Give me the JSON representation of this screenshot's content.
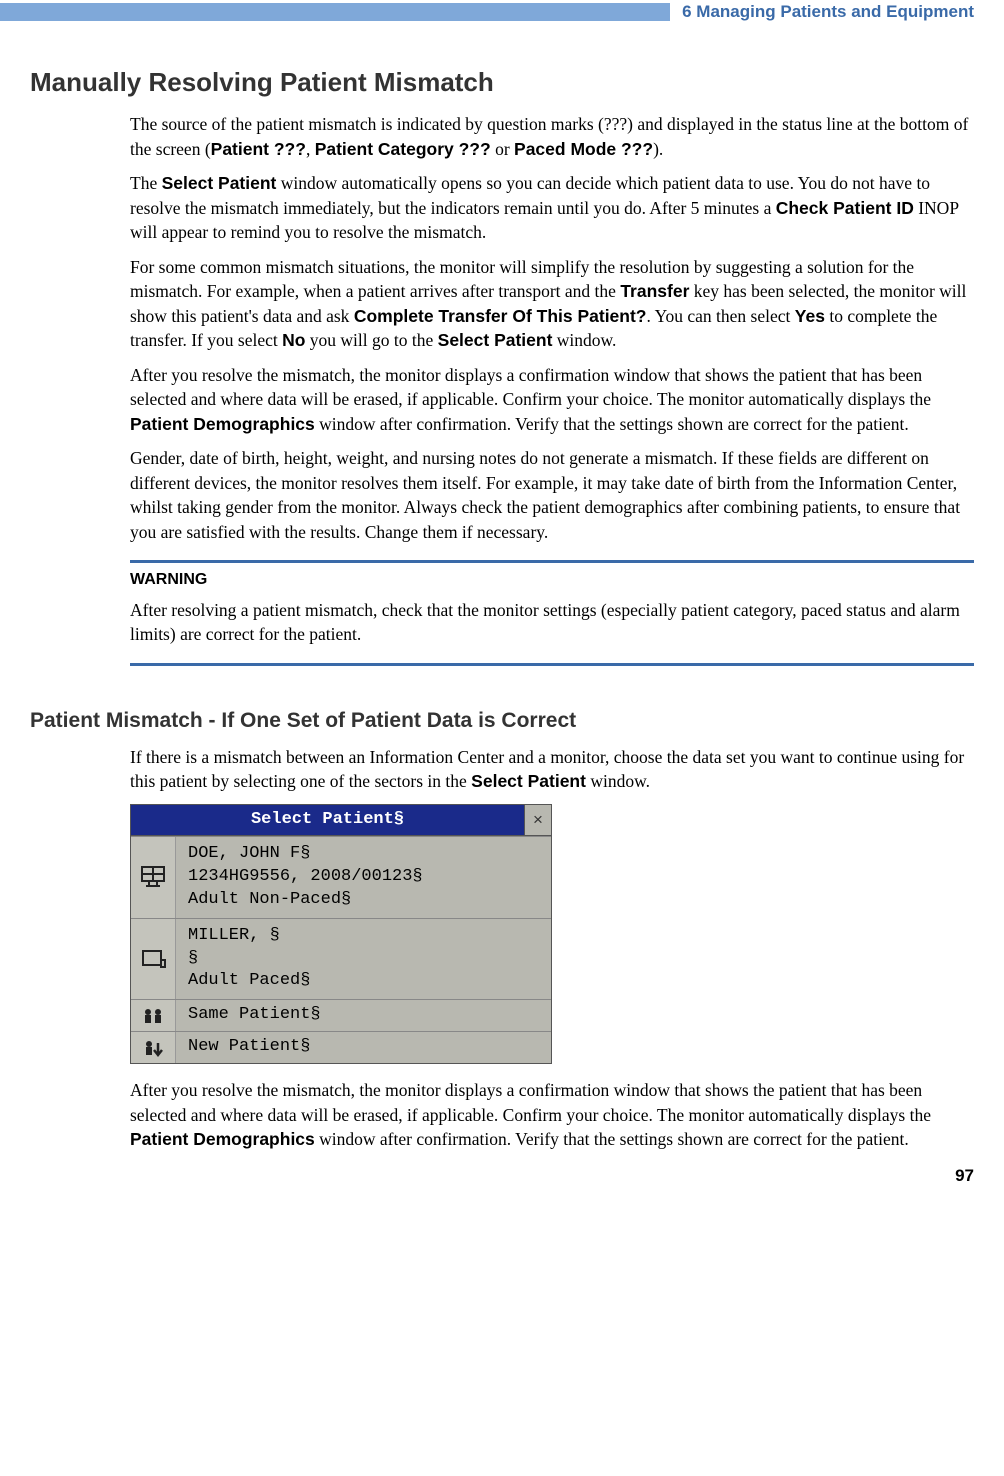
{
  "header": {
    "chapter": "6  Managing Patients and Equipment"
  },
  "section1": {
    "title": "Manually Resolving Patient Mismatch",
    "p1a": "The source of the patient mismatch is indicated by question marks (???) and displayed in the status line at the bottom of the screen (",
    "p1b": "Patient ???",
    "p1c": ", ",
    "p1d": "Patient Category ???",
    "p1e": " or ",
    "p1f": "Paced Mode ???",
    "p1g": ").",
    "p2a": "The ",
    "p2b": "Select Patient",
    "p2c": " window automatically opens so you can decide which patient data to use. You do not have to resolve the mismatch immediately, but the indicators remain until you do. After 5 minutes a ",
    "p2d": "Check Patient ID",
    "p2e": " INOP will appear to remind you to resolve the mismatch.",
    "p3a": "For some common mismatch situations, the monitor will simplify the resolution by suggesting a solution for the mismatch. For example, when a patient arrives after transport and the ",
    "p3b": "Transfer",
    "p3c": " key has been selected, the monitor will show this patient's data and ask ",
    "p3d": "Complete Transfer Of This Patient?",
    "p3e": ". You can then select ",
    "p3f": "Yes",
    "p3g": " to complete the transfer. If you select ",
    "p3h": "No",
    "p3i": " you will go to the ",
    "p3j": "Select Patient",
    "p3k": " window.",
    "p4a": "After you resolve the mismatch, the monitor displays a confirmation window that shows the patient that has been selected and where data will be erased, if applicable. Confirm your choice. The monitor automatically displays the ",
    "p4b": "Patient Demographics",
    "p4c": " window after confirmation. Verify that the settings shown are correct for the patient.",
    "p5": "Gender, date of birth, height, weight, and nursing notes do not generate a mismatch. If these fields are different on different devices, the monitor resolves them itself. For example, it may take date of birth from the Information Center, whilst taking gender from the monitor. Always check the patient demographics after combining patients, to ensure that you are satisfied with the results. Change them if necessary."
  },
  "warning": {
    "label": "WARNING",
    "text": "After resolving a patient mismatch, check that the monitor settings (especially patient category, paced status and alarm limits) are correct for the patient."
  },
  "section2": {
    "title": "Patient Mismatch - If One Set of Patient Data is Correct",
    "p1a": "If there is a mismatch between an Information Center and a monitor, choose the data set you want to continue using for this patient by selecting one of the sectors in the ",
    "p1b": "Select Patient",
    "p1c": " window.",
    "p2a": "After you resolve the mismatch, the monitor displays a confirmation window that shows the patient that has been selected and where data will be erased, if applicable. Confirm your choice. The monitor automatically displays the ",
    "p2b": "Patient Demographics",
    "p2c": " window after confirmation. Verify that the settings shown are correct for the patient."
  },
  "dialog": {
    "title": "Select Patient§",
    "close": "×",
    "row1": {
      "line1": "DOE, JOHN F§",
      "line2": "1234HG9556, 2008/00123§",
      "line3": "Adult Non-Paced§"
    },
    "row2": {
      "line1": "MILLER, §",
      "line2": "§",
      "line3": "Adult Paced§"
    },
    "row3": {
      "label": "Same Patient§"
    },
    "row4": {
      "label": "New Patient§"
    }
  },
  "pageNumber": "97"
}
